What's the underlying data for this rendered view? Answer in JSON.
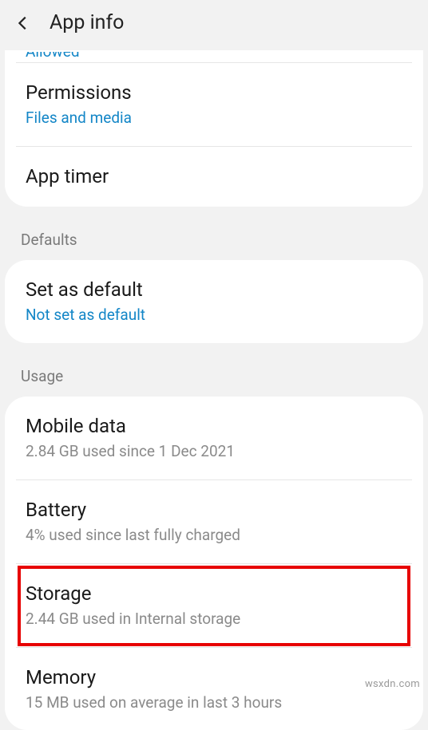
{
  "header": {
    "title": "App info"
  },
  "clipped": "Allowed",
  "section1": {
    "permissions": {
      "title": "Permissions",
      "sub": "Files and media"
    },
    "appTimer": {
      "title": "App timer"
    }
  },
  "defaults": {
    "label": "Defaults",
    "setDefault": {
      "title": "Set as default",
      "sub": "Not set as default"
    }
  },
  "usage": {
    "label": "Usage",
    "mobileData": {
      "title": "Mobile data",
      "sub": "2.84 GB used since 1 Dec 2021"
    },
    "battery": {
      "title": "Battery",
      "sub": "4% used since last fully charged"
    },
    "storage": {
      "title": "Storage",
      "sub": "2.44 GB used in Internal storage"
    },
    "memory": {
      "title": "Memory",
      "sub": "15 MB used on average in last 3 hours"
    }
  },
  "watermark": "wsxdn.com"
}
